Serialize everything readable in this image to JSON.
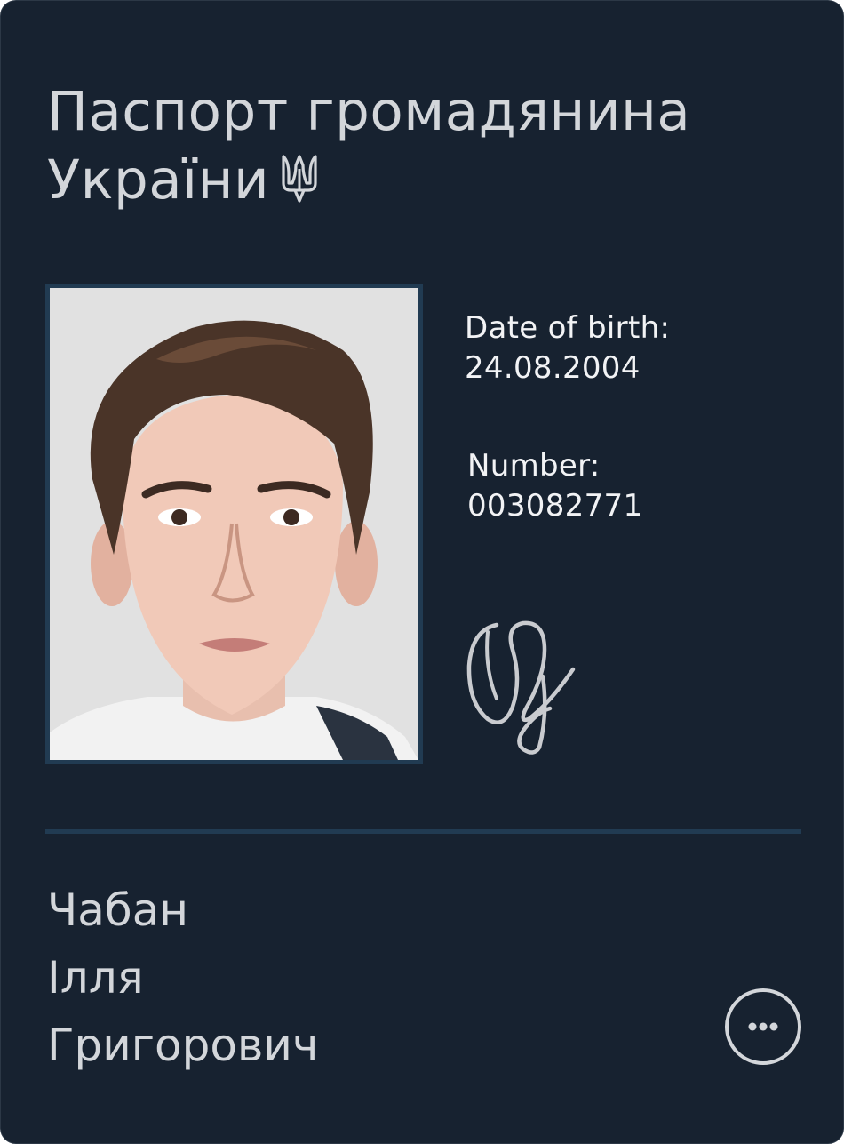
{
  "document": {
    "title_line1": "Паспорт громадянина",
    "title_line2": "України",
    "emblem_icon": "trident-icon"
  },
  "details": {
    "dob_label": "Date of birth:",
    "dob_value": "24.08.2004",
    "number_label": "Number:",
    "number_value": "003082771"
  },
  "holder": {
    "surname": "Чабан",
    "given_name": "Ілля",
    "patronymic": "Григорович"
  },
  "actions": {
    "more_icon": "more-horizontal-icon"
  },
  "colors": {
    "card_background": "#172230",
    "frame_accent": "#213b52",
    "title_text": "#d3d6da",
    "detail_text": "#f2f3f5"
  }
}
